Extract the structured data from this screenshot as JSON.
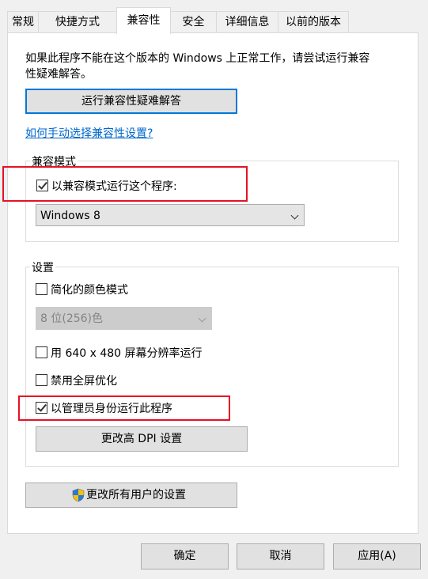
{
  "tabs": [
    "常规",
    "快捷方式",
    "兼容性",
    "安全",
    "详细信息",
    "以前的版本"
  ],
  "active_tab": "兼容性",
  "intro_text_line1": "如果此程序不能在这个版本的 Windows 上正常工作，请尝试运行兼容",
  "intro_text_line2": "性疑难解答。",
  "troubleshoot_button": "运行兼容性疑难解答",
  "manual_link": "如何手动选择兼容性设置?",
  "compat_mode": {
    "legend": "兼容模式",
    "checkbox_label": "以兼容模式运行这个程序:",
    "checked": true,
    "selected_os": "Windows 8"
  },
  "settings": {
    "legend": "设置",
    "reduced_color_label": "简化的颜色模式",
    "reduced_color_checked": false,
    "color_select_value": "8 位(256)色",
    "resolution_label": "用 640 x 480 屏幕分辨率运行",
    "resolution_checked": false,
    "fullscreen_opt_label": "禁用全屏优化",
    "fullscreen_opt_checked": false,
    "admin_label": "以管理员身份运行此程序",
    "admin_checked": true,
    "dpi_button": "更改高 DPI 设置"
  },
  "all_users_button": "更改所有用户的设置",
  "footer": {
    "ok": "确定",
    "cancel": "取消",
    "apply": "应用(A)"
  },
  "colors": {
    "highlight_box": "#e81123",
    "focus_border": "#0078d7",
    "link": "#0066cc"
  }
}
